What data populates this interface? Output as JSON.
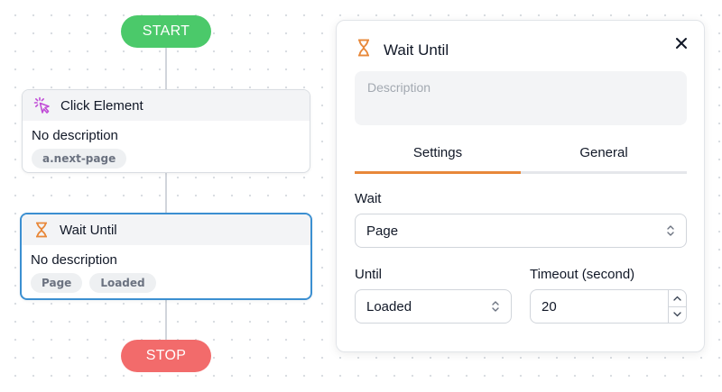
{
  "flow": {
    "start_label": "START",
    "stop_label": "STOP",
    "nodes": [
      {
        "title": "Click Element",
        "icon": "cursor-click-icon",
        "description": "No description",
        "chips": [
          "a.next-page"
        ]
      },
      {
        "title": "Wait Until",
        "icon": "hourglass-icon",
        "description": "No description",
        "chips": [
          "Page",
          "Loaded"
        ]
      }
    ]
  },
  "panel": {
    "title": "Wait Until",
    "description_placeholder": "Description",
    "tabs": [
      "Settings",
      "General"
    ],
    "active_tab": "Settings",
    "wait_label": "Wait",
    "wait_value": "Page",
    "until_label": "Until",
    "until_value": "Loaded",
    "timeout_label": "Timeout (second)",
    "timeout_value": "20"
  },
  "colors": {
    "start": "#4bc96a",
    "stop": "#f26b6b",
    "selected_border": "#3b8fd1",
    "tab_accent": "#e8883a",
    "hourglass": "#e8883a",
    "click_icon": "#c04bd6"
  }
}
